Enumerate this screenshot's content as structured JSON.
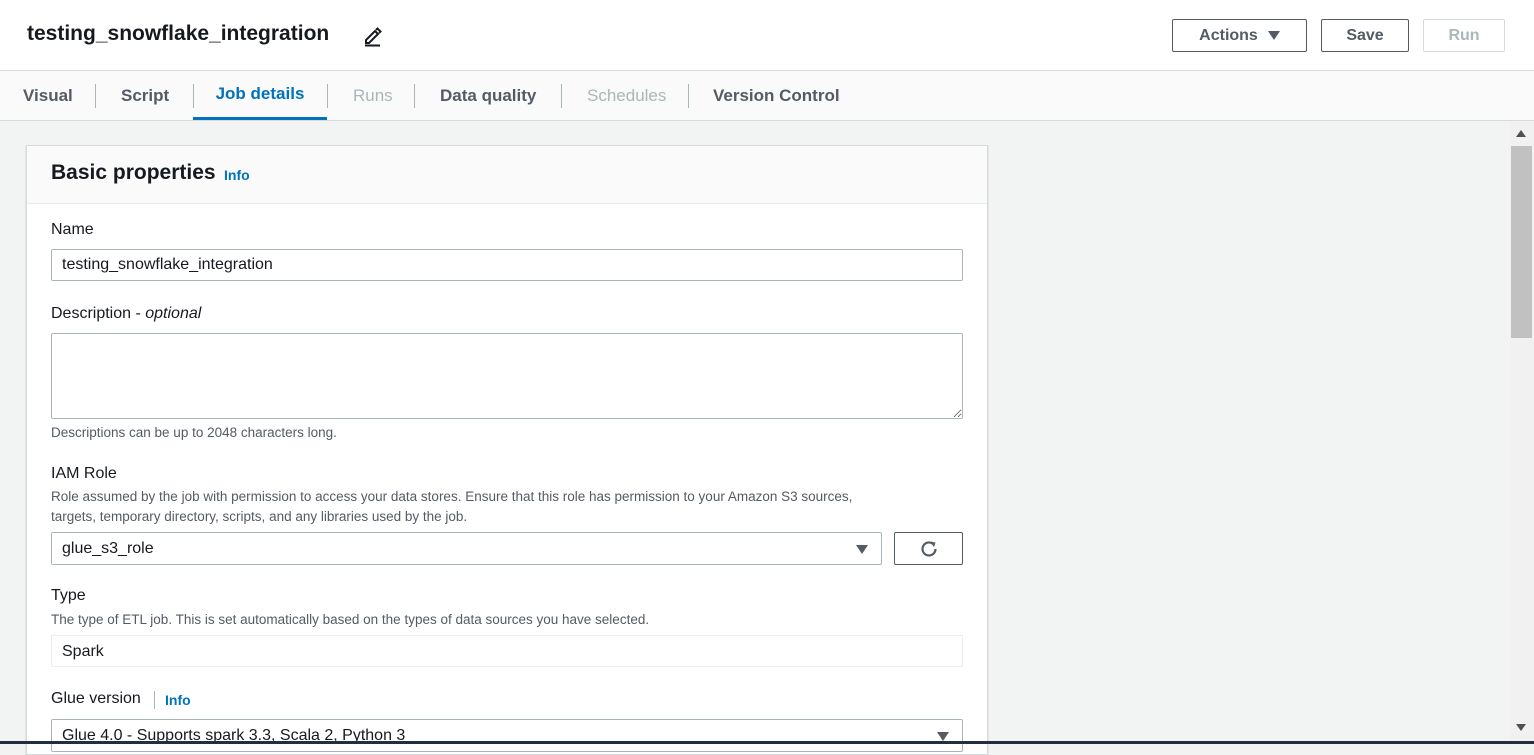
{
  "header": {
    "job_name": "testing_snowflake_integration",
    "actions_label": "Actions",
    "save_label": "Save",
    "run_label": "Run"
  },
  "tabs": [
    {
      "label": "Visual",
      "state": "normal"
    },
    {
      "label": "Script",
      "state": "normal"
    },
    {
      "label": "Job details",
      "state": "active"
    },
    {
      "label": "Runs",
      "state": "disabled"
    },
    {
      "label": "Data quality",
      "state": "normal"
    },
    {
      "label": "Schedules",
      "state": "disabled"
    },
    {
      "label": "Version Control",
      "state": "normal"
    }
  ],
  "basic_properties": {
    "title": "Basic properties",
    "info_label": "Info",
    "name": {
      "label": "Name",
      "value": "testing_snowflake_integration"
    },
    "description": {
      "label": "Description - ",
      "label_optional": "optional",
      "value": "",
      "hint": "Descriptions can be up to 2048 characters long."
    },
    "iam_role": {
      "label": "IAM Role",
      "hint_line1": "Role assumed by the job with permission to access your data stores. Ensure that this role has permission to your Amazon S3 sources,",
      "hint_line2": "targets, temporary directory, scripts, and any libraries used by the job.",
      "selected": "glue_s3_role"
    },
    "type": {
      "label": "Type",
      "hint": "The type of ETL job. This is set automatically based on the types of data sources you have selected.",
      "value": "Spark"
    },
    "glue_version": {
      "label": "Glue version",
      "info_label": "Info",
      "selected": "Glue 4.0 - Supports spark 3.3, Scala 2, Python 3"
    }
  },
  "colors": {
    "accent": "#0073bb",
    "text": "#16191f",
    "muted": "#545b64",
    "disabled": "#aab7b8"
  }
}
